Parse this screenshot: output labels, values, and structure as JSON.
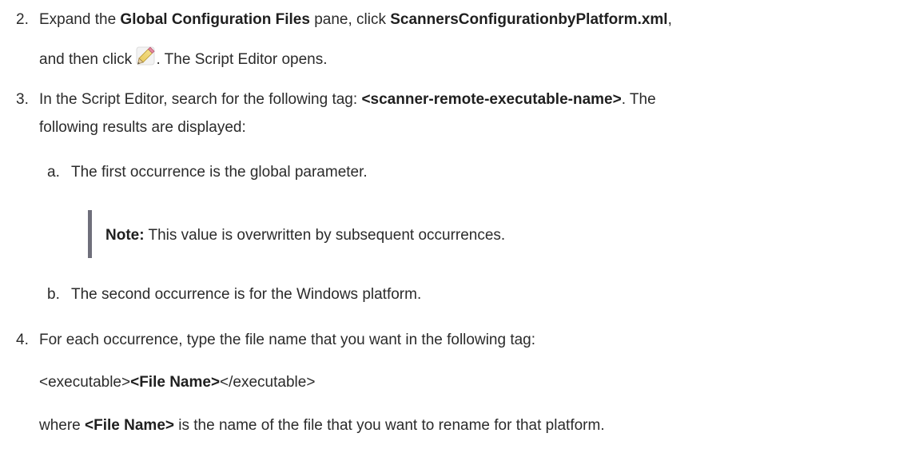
{
  "steps": [
    {
      "number": "2.",
      "line1": {
        "t1": "Expand the ",
        "b1": "Global Configuration Files",
        "t2": " pane, click ",
        "b2": "ScannersConfigurationbyPlatform.xml",
        "t3": ","
      },
      "line2": {
        "t1": "and then click ",
        "icon": "pencil-edit-icon",
        "t2": ". The Script Editor opens."
      }
    },
    {
      "number": "3.",
      "line1": {
        "t1": "In the Script Editor, search for the following tag: ",
        "b1": "<scanner-remote-executable-name>",
        "t2": ". The"
      },
      "line2": "following results are displayed:",
      "substeps": [
        {
          "letter": "a.",
          "text": "The first occurrence is the global parameter.",
          "note": {
            "label": "Note:",
            "text": " This value is overwritten by subsequent occurrences."
          }
        },
        {
          "letter": "b.",
          "text": "The second occurrence is for the Windows platform."
        }
      ]
    },
    {
      "number": "4.",
      "line1": "For each occurrence, type the file name that you want in the following tag:",
      "code": {
        "open": "<executable>",
        "bold": "<File Name>",
        "close": "</executable>"
      },
      "where": {
        "t1": "where ",
        "b1": "<File Name>",
        "t2": " is the name of the file that you want to rename for that platform."
      }
    }
  ]
}
